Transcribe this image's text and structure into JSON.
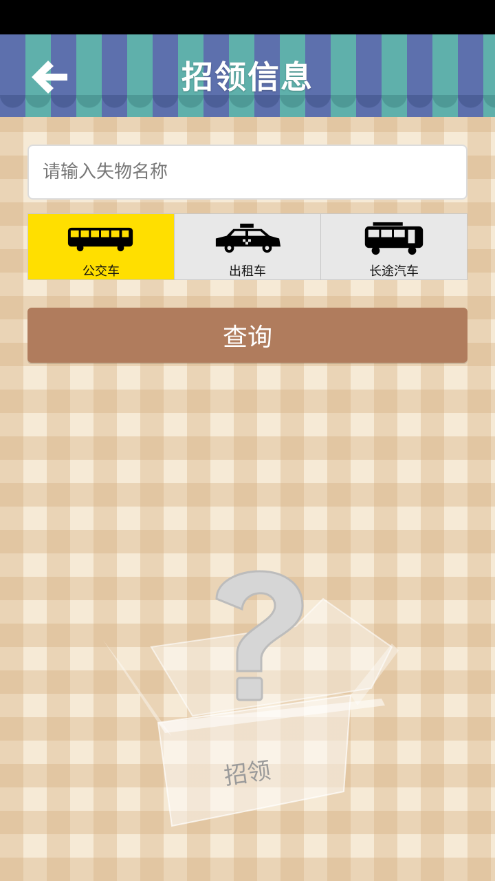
{
  "header": {
    "title": "招领信息",
    "back_icon": "arrow-left-icon"
  },
  "search": {
    "placeholder": "请输入失物名称",
    "value": ""
  },
  "transport_tabs": [
    {
      "label": "公交车",
      "icon": "bus-icon",
      "selected": true
    },
    {
      "label": "出租车",
      "icon": "taxi-icon",
      "selected": false
    },
    {
      "label": "长途汽车",
      "icon": "coach-icon",
      "selected": false
    }
  ],
  "query_button": {
    "label": "查询"
  },
  "empty_state": {
    "box_label": "招领",
    "icon": "question-box-icon"
  },
  "colors": {
    "header_blue": "#5d70ad",
    "header_teal": "#5fb0ab",
    "selected_tab": "#ffdf00",
    "query_button": "#b07c5d"
  }
}
